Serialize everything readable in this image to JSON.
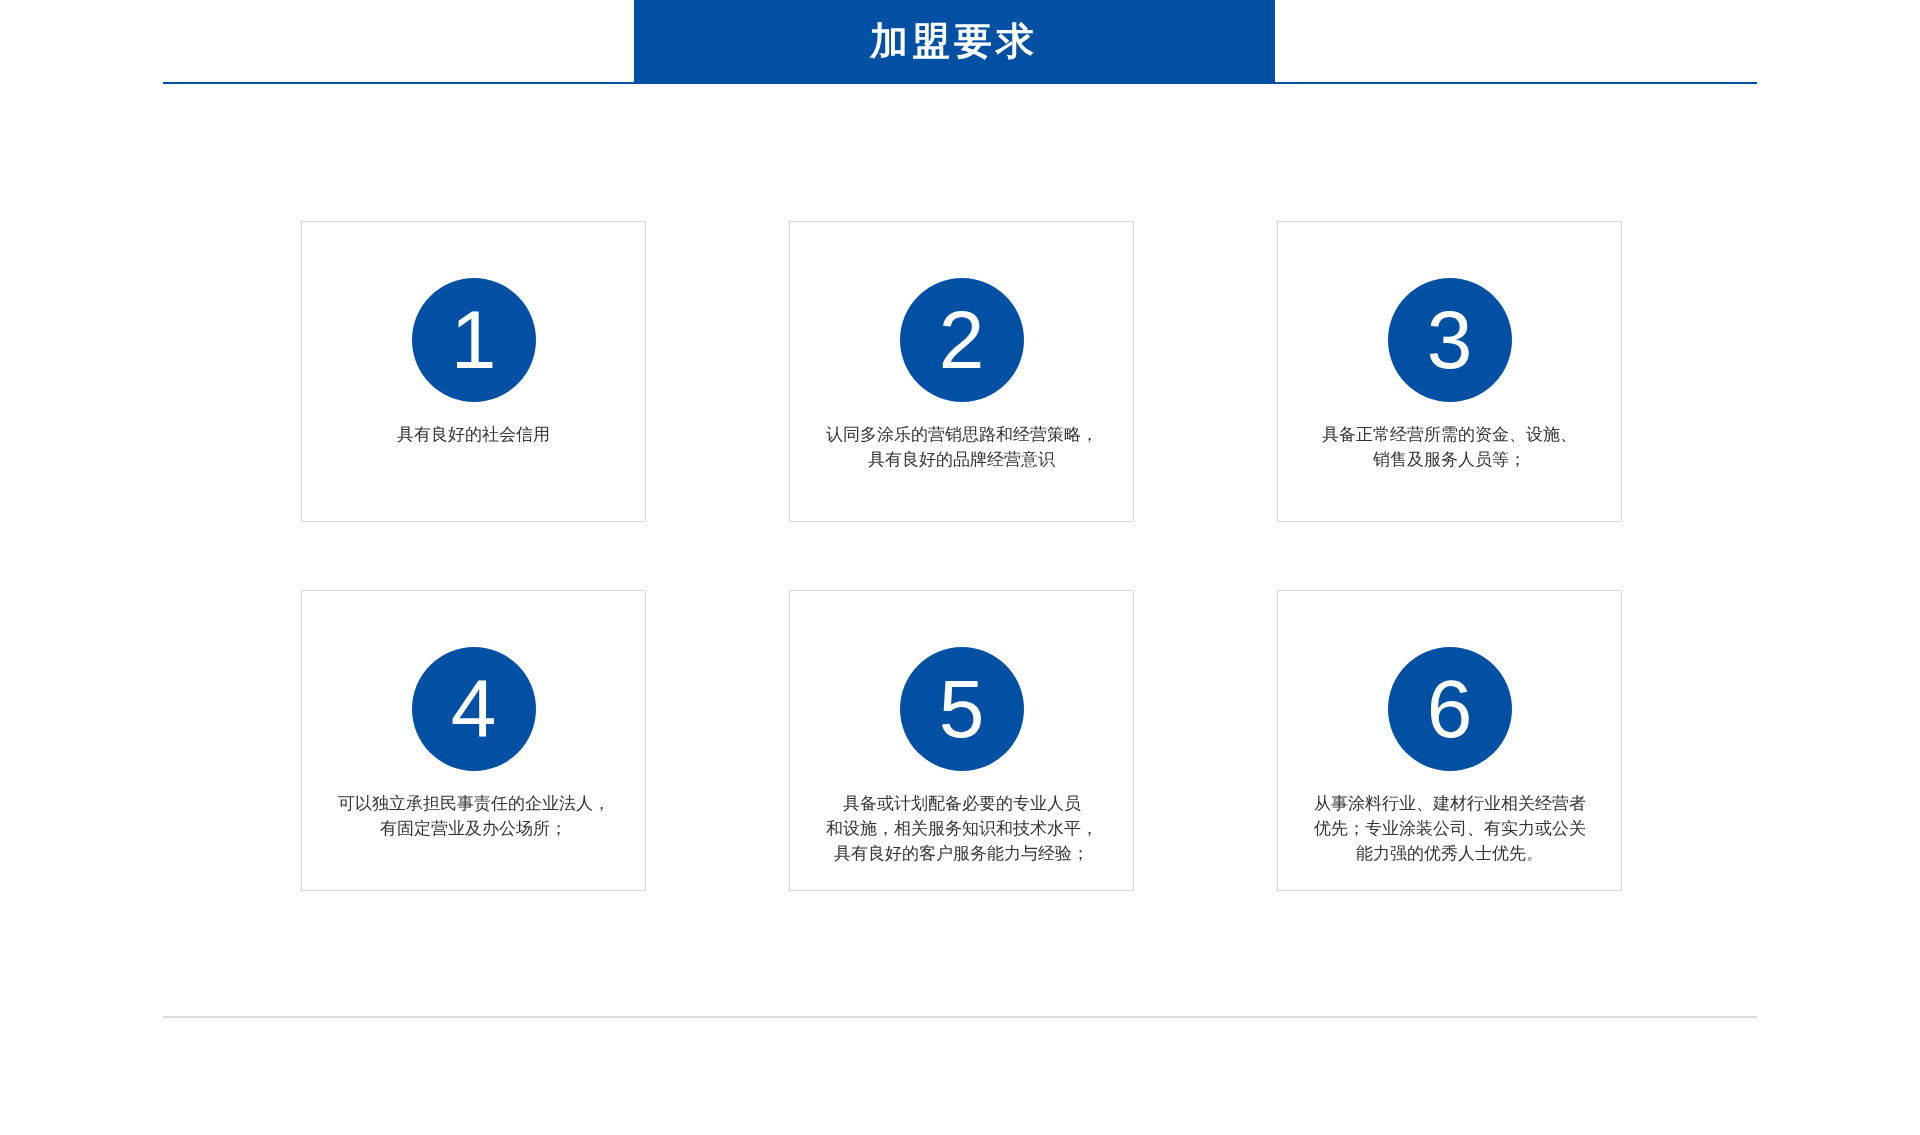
{
  "header": {
    "title": "加盟要求"
  },
  "cards": [
    {
      "number": "1",
      "lines": [
        "具有良好的社会信用"
      ]
    },
    {
      "number": "2",
      "lines": [
        "认同多涂乐的营销思路和经营策略，",
        "具有良好的品牌经营意识"
      ]
    },
    {
      "number": "3",
      "lines": [
        "具备正常经营所需的资金、设施、",
        "销售及服务人员等；"
      ]
    },
    {
      "number": "4",
      "lines": [
        "可以独立承担民事责任的企业法人，",
        "有固定营业及办公场所；"
      ]
    },
    {
      "number": "5",
      "lines": [
        "具备或计划配备必要的专业人员",
        "和设施，相关服务知识和技术水平，",
        "具有良好的客户服务能力与经验；"
      ]
    },
    {
      "number": "6",
      "lines": [
        "从事涂料行业、建材行业相关经营者",
        "优先；专业涂装公司、有实力或公关",
        "能力强的优秀人士优先。"
      ]
    }
  ]
}
